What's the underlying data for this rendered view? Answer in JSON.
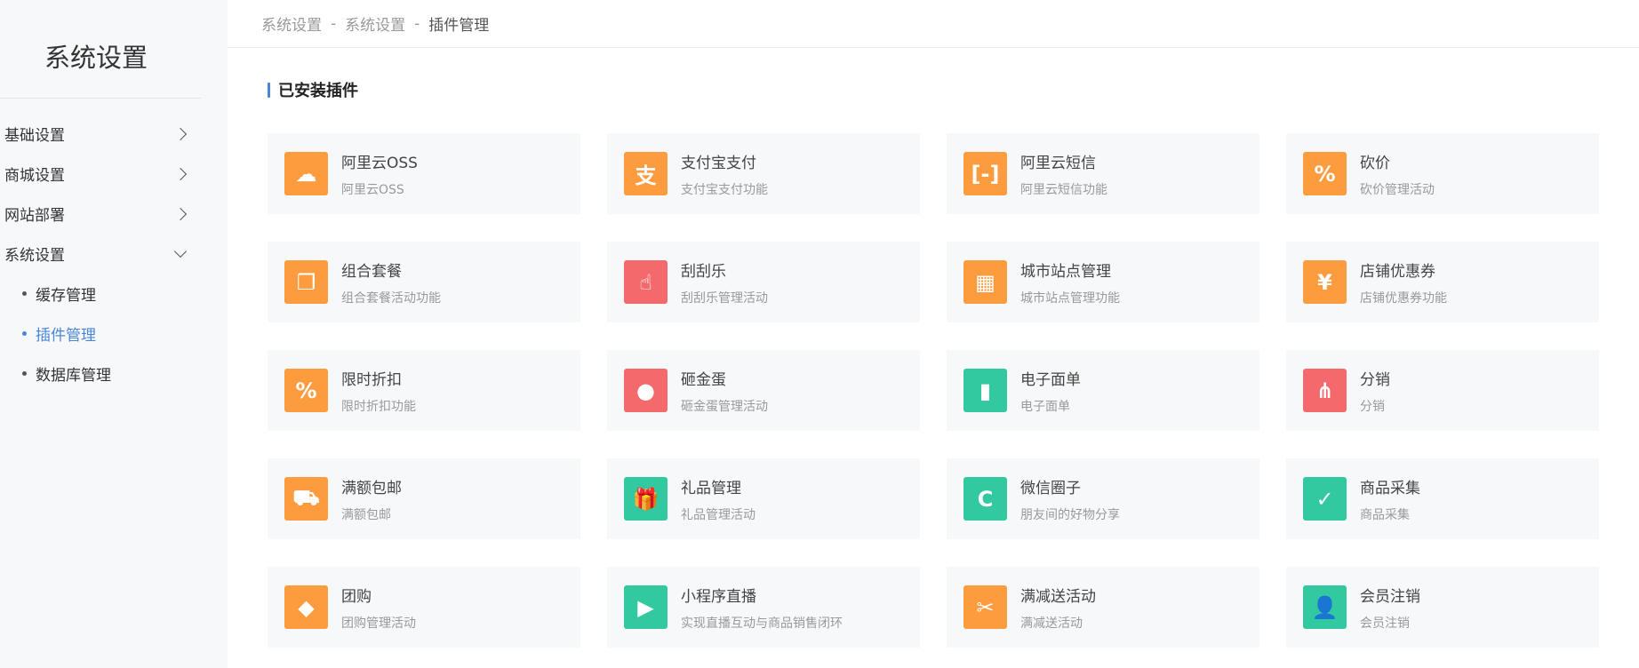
{
  "sidebar": {
    "title": "系统设置",
    "menu": [
      {
        "label": "基础设置"
      },
      {
        "label": "商城设置"
      },
      {
        "label": "网站部署"
      },
      {
        "label": "系统设置"
      }
    ],
    "submenu": [
      {
        "label": "缓存管理"
      },
      {
        "label": "插件管理"
      },
      {
        "label": "数据库管理"
      }
    ]
  },
  "breadcrumb": {
    "items": [
      "系统设置",
      "系统设置",
      "插件管理"
    ],
    "separator": "-"
  },
  "section": {
    "title": "已安装插件"
  },
  "colors": {
    "orange": "#fd9b3f",
    "red": "#f46a6c",
    "green": "#33c9a0",
    "accent": "#4a86d8"
  },
  "plugins": [
    {
      "title": "阿里云OSS",
      "desc": "阿里云OSS",
      "color": "orange",
      "icon": "cloud-upload-icon",
      "glyph": "☁"
    },
    {
      "title": "支付宝支付",
      "desc": "支付宝支付功能",
      "color": "orange",
      "icon": "alipay-icon",
      "glyph": "支"
    },
    {
      "title": "阿里云短信",
      "desc": "阿里云短信功能",
      "color": "orange",
      "icon": "aliyun-icon",
      "glyph": "[-]"
    },
    {
      "title": "砍价",
      "desc": "砍价管理活动",
      "color": "orange",
      "icon": "price-tag-icon",
      "glyph": "%"
    },
    {
      "title": "组合套餐",
      "desc": "组合套餐活动功能",
      "color": "orange",
      "icon": "combo-icon",
      "glyph": "❐"
    },
    {
      "title": "刮刮乐",
      "desc": "刮刮乐管理活动",
      "color": "red",
      "icon": "scratch-card-icon",
      "glyph": "☝"
    },
    {
      "title": "城市站点管理",
      "desc": "城市站点管理功能",
      "color": "orange",
      "icon": "building-icon",
      "glyph": "▦"
    },
    {
      "title": "店铺优惠券",
      "desc": "店铺优惠券功能",
      "color": "orange",
      "icon": "coupon-icon",
      "glyph": "¥"
    },
    {
      "title": "限时折扣",
      "desc": "限时折扣功能",
      "color": "orange",
      "icon": "discount-badge-icon",
      "glyph": "%"
    },
    {
      "title": "砸金蛋",
      "desc": "砸金蛋管理活动",
      "color": "red",
      "icon": "egg-icon",
      "glyph": "●"
    },
    {
      "title": "电子面单",
      "desc": "电子面单",
      "color": "green",
      "icon": "bookmark-icon",
      "glyph": "▮"
    },
    {
      "title": "分销",
      "desc": "分销",
      "color": "red",
      "icon": "distribution-tree-icon",
      "glyph": "⋔"
    },
    {
      "title": "满额包邮",
      "desc": "满额包邮",
      "color": "orange",
      "icon": "truck-icon",
      "glyph": "⛟"
    },
    {
      "title": "礼品管理",
      "desc": "礼品管理活动",
      "color": "green",
      "icon": "gift-icon",
      "glyph": "🎁"
    },
    {
      "title": "微信圈子",
      "desc": "朋友间的好物分享",
      "color": "green",
      "icon": "circle-icon",
      "glyph": "C"
    },
    {
      "title": "商品采集",
      "desc": "商品采集",
      "color": "green",
      "icon": "bag-check-icon",
      "glyph": "✓"
    },
    {
      "title": "团购",
      "desc": "团购管理活动",
      "color": "orange",
      "icon": "tag-icon",
      "glyph": "◆"
    },
    {
      "title": "小程序直播",
      "desc": "实现直播互动与商品销售闭环",
      "color": "green",
      "icon": "tv-play-icon",
      "glyph": "▶"
    },
    {
      "title": "满减送活动",
      "desc": "满减送活动",
      "color": "orange",
      "icon": "ticket-icon",
      "glyph": "✂"
    },
    {
      "title": "会员注销",
      "desc": "会员注销",
      "color": "green",
      "icon": "user-remove-icon",
      "glyph": "👤"
    }
  ]
}
